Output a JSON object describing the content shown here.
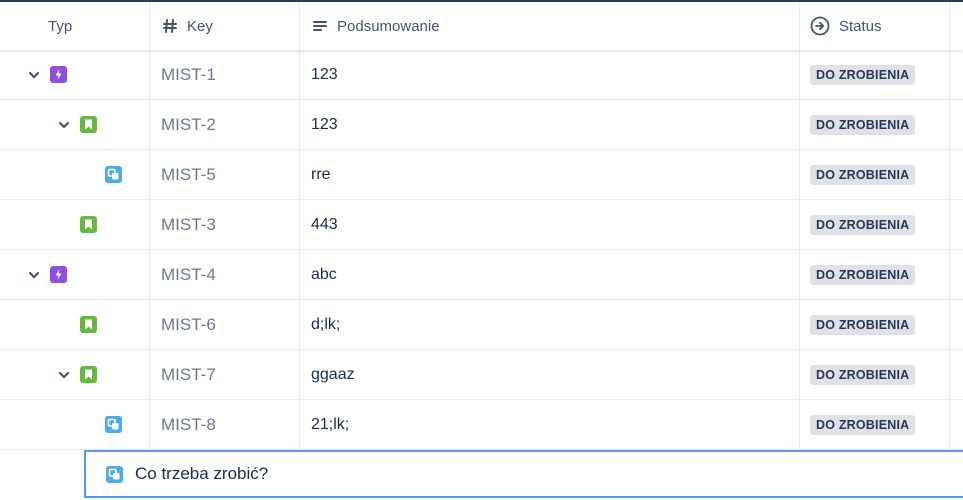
{
  "colors": {
    "epic": "#904ee2",
    "story": "#63ba3c",
    "subtask": "#4bade8",
    "badge_bg": "#dfe1e6",
    "focus_border": "#4c9aff"
  },
  "columns": [
    {
      "label": "Typ",
      "icon": ""
    },
    {
      "label": "Key",
      "icon": "hash-icon"
    },
    {
      "label": "Podsumowanie",
      "icon": "summary-lines-icon"
    },
    {
      "label": "Status",
      "icon": "status-arrow-circle-icon"
    }
  ],
  "rows": [
    {
      "key": "MIST-1",
      "summary": "123",
      "status": "DO ZROBIENIA",
      "type": "epic-icon",
      "expanded": true
    },
    {
      "key": "MIST-2",
      "summary": "123",
      "status": "DO ZROBIENIA",
      "type": "story-icon",
      "expanded": true
    },
    {
      "key": "MIST-5",
      "summary": "rre",
      "status": "DO ZROBIENIA",
      "type": "subtask-icon",
      "expanded": false
    },
    {
      "key": "MIST-3",
      "summary": "443",
      "status": "DO ZROBIENIA",
      "type": "story-icon",
      "expanded": false
    },
    {
      "key": "MIST-4",
      "summary": "abc",
      "status": "DO ZROBIENIA",
      "type": "epic-icon",
      "expanded": true
    },
    {
      "key": "MIST-6",
      "summary": "d;lk;",
      "status": "DO ZROBIENIA",
      "type": "story-icon",
      "expanded": false
    },
    {
      "key": "MIST-7",
      "summary": "ggaaz",
      "status": "DO ZROBIENIA",
      "type": "story-icon",
      "expanded": true
    },
    {
      "key": "MIST-8",
      "summary": "21;lk;",
      "status": "DO ZROBIENIA",
      "type": "subtask-icon",
      "expanded": false
    }
  ],
  "create": {
    "placeholder": "Co trzeba zrobić?",
    "type": "subtask-icon"
  }
}
